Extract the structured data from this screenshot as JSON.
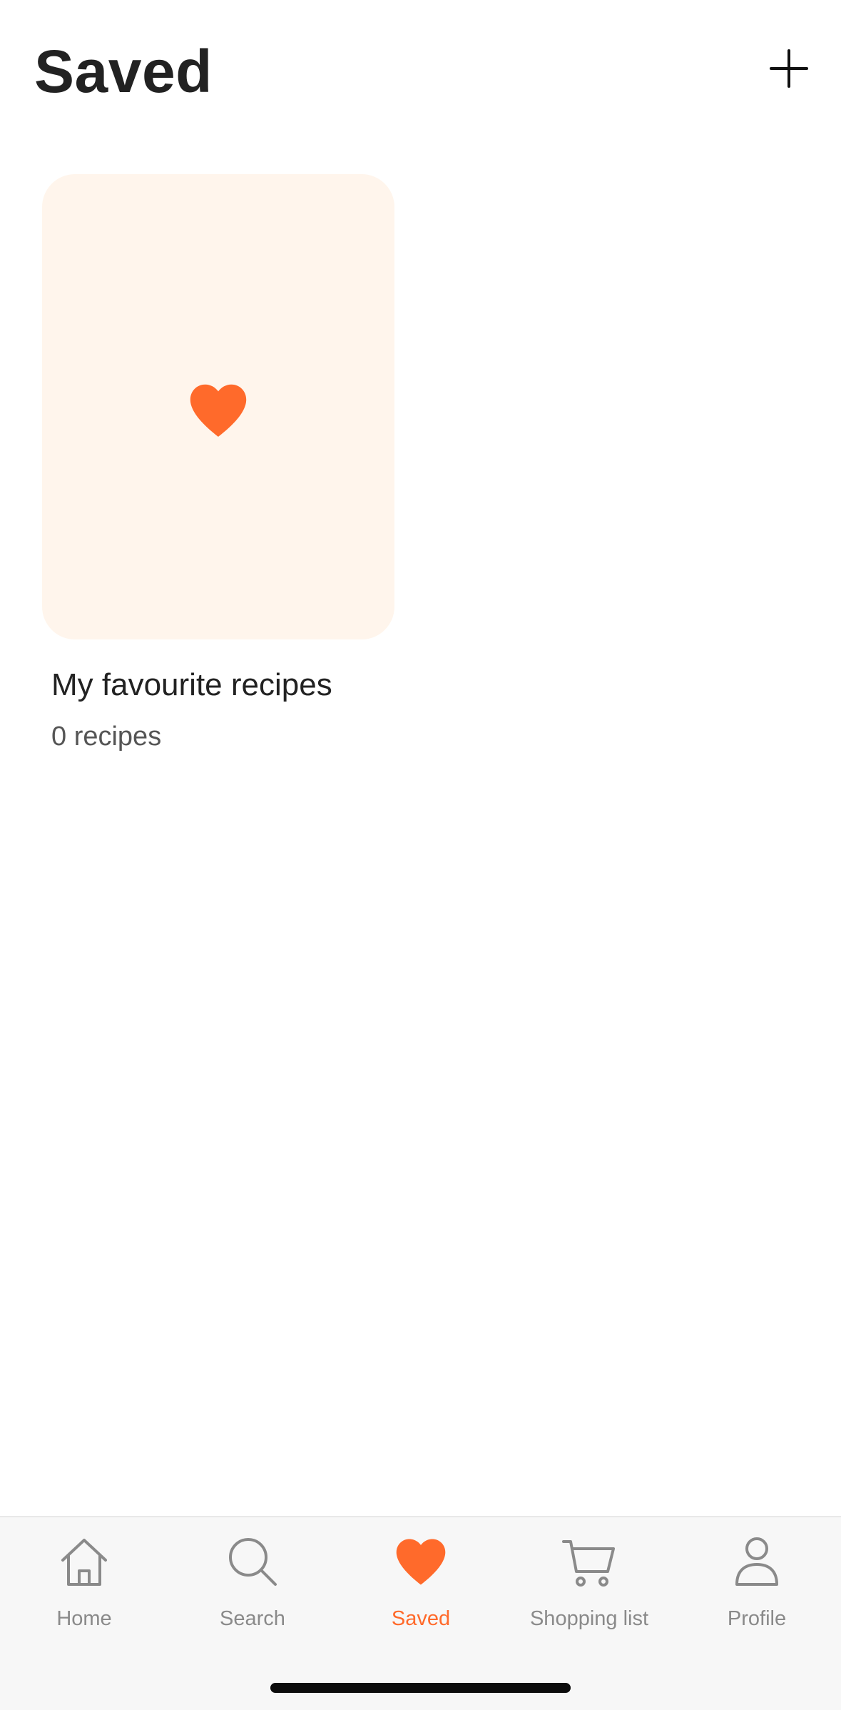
{
  "header": {
    "title": "Saved",
    "add_icon": "plus-icon"
  },
  "collections": [
    {
      "title": "My favourite recipes",
      "count": "0 recipes",
      "icon": "heart-icon"
    }
  ],
  "nav": {
    "items": [
      {
        "label": "Home",
        "icon": "home-icon",
        "active": false
      },
      {
        "label": "Search",
        "icon": "search-icon",
        "active": false
      },
      {
        "label": "Saved",
        "icon": "heart-icon",
        "active": true
      },
      {
        "label": "Shopping list",
        "icon": "cart-icon",
        "active": false
      },
      {
        "label": "Profile",
        "icon": "profile-icon",
        "active": false
      }
    ]
  },
  "colors": {
    "accent": "#ff6a2b",
    "card_background": "#fff5ec",
    "inactive": "#8a8a8a",
    "text": "#222222"
  }
}
